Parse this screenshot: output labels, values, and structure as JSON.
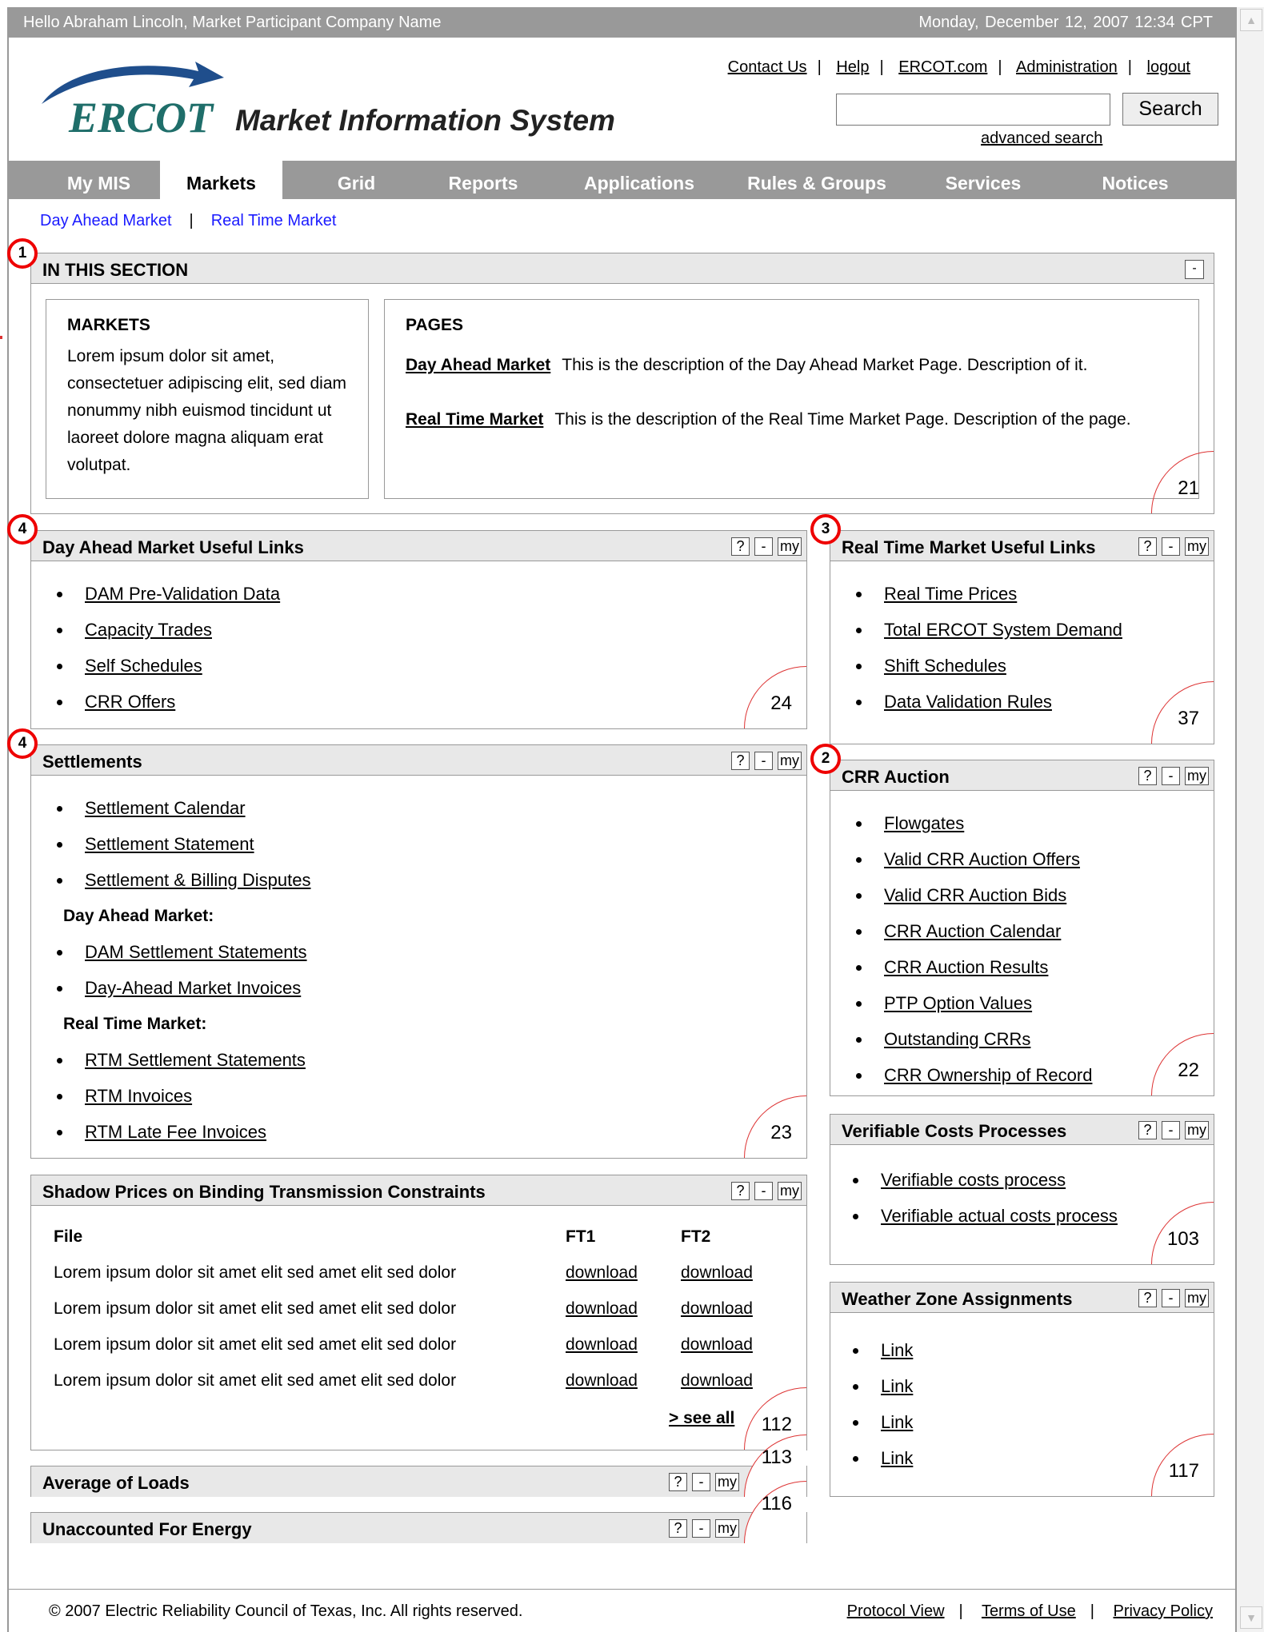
{
  "topbar": {
    "greeting": "Hello Abraham Lincoln, Market Participant Company Name",
    "datetime": "Monday, December 12, 2007   12:34 CPT"
  },
  "header": {
    "logo_text": "ERCOT",
    "app_title": "Market Information System",
    "links": [
      "Contact Us",
      "Help",
      "ERCOT.com",
      "Administration",
      "logout"
    ],
    "search_value": "",
    "search_button": "Search",
    "advanced_search": "advanced search"
  },
  "nav": {
    "tabs": [
      "My MIS",
      "Markets",
      "Grid",
      "Reports",
      "Applications",
      "Rules & Groups",
      "Services",
      "Notices"
    ],
    "active": "Markets"
  },
  "subnav": [
    "Day Ahead Market",
    "Real Time Market"
  ],
  "markers": [
    "1",
    "4",
    "3",
    "4",
    "2"
  ],
  "in_section": {
    "title": "IN THIS SECTION",
    "min": "-",
    "markets_title": "MARKETS",
    "markets_text": "Lorem ipsum dolor sit amet, consectetuer adipiscing elit, sed diam nonummy nibh euismod tincidunt ut laoreet dolore magna aliquam erat volutpat.",
    "pages_title": "PAGES",
    "pages": [
      {
        "name": "Day Ahead Market",
        "desc": "This is the description of the Day Ahead Market Page. Description of it."
      },
      {
        "name": "Real Time Market",
        "desc": "This is the description of the Real Time Market Page. Description of the page."
      }
    ],
    "num": "21"
  },
  "btns": {
    "help": "?",
    "min": "-",
    "my": "my"
  },
  "dam_links": {
    "title": "Day Ahead Market Useful Links",
    "items": [
      "DAM Pre-Validation Data",
      "Capacity Trades",
      "Self Schedules",
      "CRR Offers"
    ],
    "num": "24"
  },
  "rtm_links": {
    "title": "Real Time Market Useful Links",
    "items": [
      "Real Time Prices",
      "Total ERCOT System Demand",
      "Shift Schedules",
      "Data Validation Rules"
    ],
    "num": "37"
  },
  "settlements": {
    "title": "Settlements",
    "items": [
      "Settlement Calendar",
      "Settlement Statement",
      "Settlement & Billing Disputes"
    ],
    "dam_heading": "Day Ahead Market:",
    "dam_items": [
      "DAM Settlement Statements",
      "Day-Ahead Market Invoices"
    ],
    "rtm_heading": "Real Time Market:",
    "rtm_items": [
      "RTM Settlement Statements",
      "RTM Invoices",
      "RTM Late Fee Invoices"
    ],
    "num": "23"
  },
  "crr": {
    "title": "CRR Auction",
    "items": [
      "Flowgates",
      "Valid CRR Auction Offers",
      "Valid CRR Auction Bids",
      "CRR Auction Calendar",
      "CRR Auction Results",
      "PTP Option Values",
      "Outstanding CRRs",
      "CRR Ownership of Record"
    ],
    "num": "22"
  },
  "verifiable": {
    "title": "Verifiable Costs Processes",
    "items": [
      "Verifiable costs process",
      "Verifiable actual costs process"
    ],
    "num": "103"
  },
  "weather": {
    "title": "Weather Zone Assignments",
    "items": [
      "Link",
      "Link",
      "Link",
      "Link"
    ],
    "num": "117"
  },
  "shadow": {
    "title": "Shadow Prices on Binding Transmission Constraints",
    "headers": [
      "File",
      "FT1",
      "FT2"
    ],
    "rows": [
      [
        "Lorem ipsum dolor sit amet elit sed amet elit sed dolor",
        "download",
        "download"
      ],
      [
        "Lorem ipsum dolor sit amet elit sed amet elit sed dolor",
        "download",
        "download"
      ],
      [
        "Lorem ipsum dolor sit amet elit sed amet elit sed dolor",
        "download",
        "download"
      ],
      [
        "Lorem ipsum dolor sit amet elit sed amet elit sed dolor",
        "download",
        "download"
      ]
    ],
    "see_all": "> see all",
    "num": "112"
  },
  "avg_loads": {
    "title": "Average of Loads",
    "num": "113"
  },
  "ufe": {
    "title": "Unaccounted For Energy",
    "num": "116"
  },
  "footer": {
    "copyright": "© 2007 Electric Reliability Council of Texas, Inc.  All rights reserved.",
    "links": [
      "Protocol View",
      "Terms of Use",
      "Privacy Policy"
    ]
  }
}
